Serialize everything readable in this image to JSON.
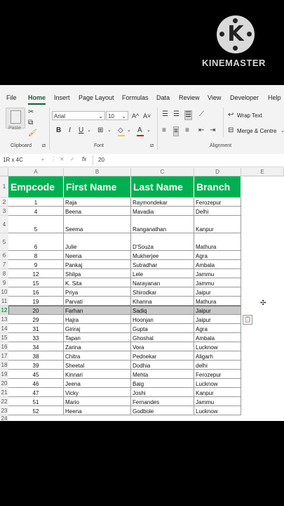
{
  "watermark": {
    "letter": "K",
    "brand": "KINEMASTER"
  },
  "menu": {
    "tabs": [
      "File",
      "Home",
      "Insert",
      "Page Layout",
      "Formulas",
      "Data",
      "Review",
      "View",
      "Developer",
      "Help"
    ],
    "active": "Home"
  },
  "ribbon": {
    "paste": "Paste",
    "font_name": "Arial",
    "font_size": "10",
    "grow": "A^",
    "shrink": "A˅",
    "bold": "B",
    "italic": "I",
    "underline": "U",
    "wrap_text": "Wrap Text",
    "merge_centre": "Merge & Centre",
    "groups": {
      "clipboard": "Clipboard",
      "font": "Font",
      "alignment": "Alignment"
    }
  },
  "formula_bar": {
    "name_box": "1R x 4C",
    "fx": "fx",
    "value": "20"
  },
  "columns": [
    "A",
    "B",
    "C",
    "D",
    "E"
  ],
  "header": [
    "Empcode",
    "First Name",
    "Last Name",
    "Branch"
  ],
  "rows": [
    {
      "n": "2",
      "code": "1",
      "first": "Raja",
      "last": "Raymondekar",
      "branch": "Ferozepur"
    },
    {
      "n": "3",
      "code": "4",
      "first": "Beena",
      "last": "Mavadia",
      "branch": "Delhi"
    },
    {
      "n": "4",
      "code": "5",
      "first": "Seema",
      "last": "Ranganathan",
      "branch": "Kanpur"
    },
    {
      "n": "5",
      "code": "6",
      "first": "Julie",
      "last": "D'Souza",
      "branch": "Mathura"
    },
    {
      "n": "6",
      "code": "8",
      "first": "Neena",
      "last": "Mukherjee",
      "branch": "Agra"
    },
    {
      "n": "7",
      "code": "9",
      "first": "Pankaj",
      "last": "Sutradhar",
      "branch": "Ambala"
    },
    {
      "n": "8",
      "code": "12",
      "first": "Shilpa",
      "last": "Lele",
      "branch": "Jammu"
    },
    {
      "n": "9",
      "code": "15",
      "first": "K. Sita",
      "last": "Narayanan",
      "branch": "Jammu"
    },
    {
      "n": "10",
      "code": "16",
      "first": "Priya",
      "last": "Shirodkar",
      "branch": "Jaipur"
    },
    {
      "n": "11",
      "code": "19",
      "first": "Parvati",
      "last": "Khanna",
      "branch": "Mathura"
    },
    {
      "n": "12",
      "code": "20",
      "first": "Farhan",
      "last": "Sadiq",
      "branch": "Jaipur"
    },
    {
      "n": "13",
      "code": "29",
      "first": "Hajra",
      "last": "Hoonjan",
      "branch": "Jaipur"
    },
    {
      "n": "14",
      "code": "31",
      "first": "Giriraj",
      "last": "Gupta",
      "branch": "Agra"
    },
    {
      "n": "15",
      "code": "33",
      "first": "Tapan",
      "last": "Ghoshal",
      "branch": "Ambala"
    },
    {
      "n": "16",
      "code": "34",
      "first": "Zarina",
      "last": "Vora",
      "branch": "Lucknow"
    },
    {
      "n": "17",
      "code": "38",
      "first": "Chitra",
      "last": "Pednekar",
      "branch": "Aligarh"
    },
    {
      "n": "18",
      "code": "39",
      "first": "Sheetal",
      "last": "Dodhia",
      "branch": "delhi"
    },
    {
      "n": "19",
      "code": "45",
      "first": "Kinnari",
      "last": "Mehta",
      "branch": "Ferozepur"
    },
    {
      "n": "20",
      "code": "46",
      "first": "Jeena",
      "last": "Baig",
      "branch": "Lucknow"
    },
    {
      "n": "21",
      "code": "47",
      "first": "Vicky",
      "last": "Joshi",
      "branch": "Kanpur"
    },
    {
      "n": "22",
      "code": "51",
      "first": "Mario",
      "last": "Fernandes",
      "branch": "Jammu"
    },
    {
      "n": "23",
      "code": "52",
      "first": "Heena",
      "last": "Godbole",
      "branch": "Lucknow"
    }
  ],
  "extra_row": "24",
  "selected_row": "12",
  "colors": {
    "header_fill": "#00b050",
    "selected_fill": "#c9c9c9",
    "accent": "#185c37"
  }
}
